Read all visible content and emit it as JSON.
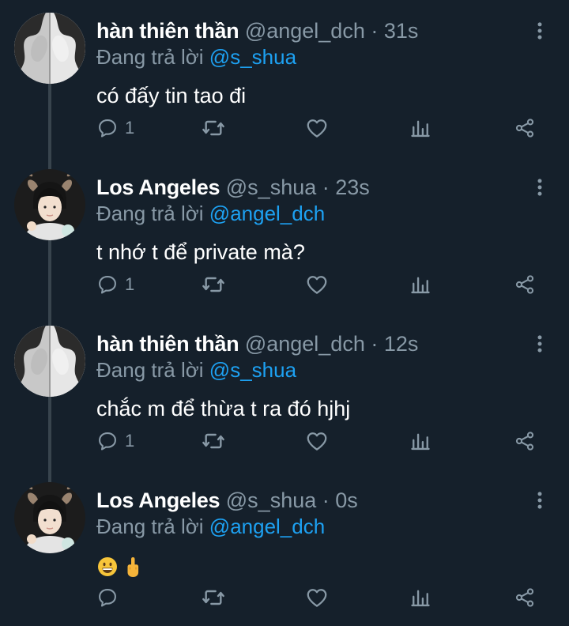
{
  "tweets": [
    {
      "name": "hàn thiên thần",
      "handle": "@angel_dch",
      "time": "· 31s",
      "reply_prefix": "Đang trả lời",
      "reply_to": "@s_shua",
      "text": "có đấy tin tao đi",
      "reply_count": "1",
      "avatar_icon": "mirror-portrait-avatar"
    },
    {
      "name": "Los Angeles",
      "handle": "@s_shua",
      "time": "· 23s",
      "reply_prefix": "Đang trả lời",
      "reply_to": "@angel_dch",
      "text": "t nhớ t để private mà?",
      "reply_count": "1",
      "avatar_icon": "deer-ears-portrait-avatar"
    },
    {
      "name": "hàn thiên thần",
      "handle": "@angel_dch",
      "time": "· 12s",
      "reply_prefix": "Đang trả lời",
      "reply_to": "@s_shua",
      "text": "chắc m để thừa t ra đó hjhj",
      "reply_count": "1",
      "avatar_icon": "mirror-portrait-avatar"
    },
    {
      "name": "Los Angeles",
      "handle": "@s_shua",
      "time": "· 0s",
      "reply_prefix": "Đang trả lời",
      "reply_to": "@angel_dch",
      "text": "",
      "emojis": [
        "grinning-face-emoji",
        "middle-finger-emoji"
      ],
      "reply_count": "",
      "avatar_icon": "deer-ears-portrait-avatar"
    }
  ],
  "icons": {
    "reply": "reply-icon",
    "retweet": "retweet-icon",
    "like": "heart-icon",
    "analytics": "analytics-icon",
    "share": "share-icon",
    "more": "more-vertical-icon"
  },
  "colors": {
    "background": "#15202b",
    "secondary_text": "#8899a6",
    "mention": "#1da1f2",
    "thread_line": "#38444d"
  }
}
